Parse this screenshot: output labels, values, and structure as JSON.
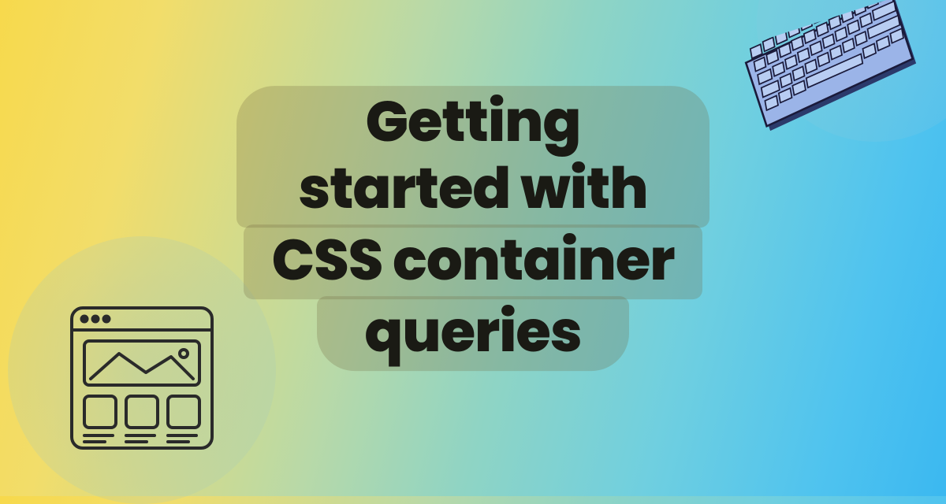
{
  "title": {
    "line1": "Getting started with",
    "line2": "CSS container",
    "line3": "queries"
  },
  "icons": {
    "browser": "browser-window-icon",
    "keyboard": "keyboard-icon"
  },
  "colors": {
    "text": "#1a1a14",
    "pill_bg": "rgba(110,100,60,0.25)",
    "bg_left": "#f7d94c",
    "bg_right": "#3bb8f0",
    "keyboard_fill": "#9bb4e8",
    "keyboard_stroke": "#1a1a3a",
    "icon_stroke": "#2a2a2a"
  }
}
